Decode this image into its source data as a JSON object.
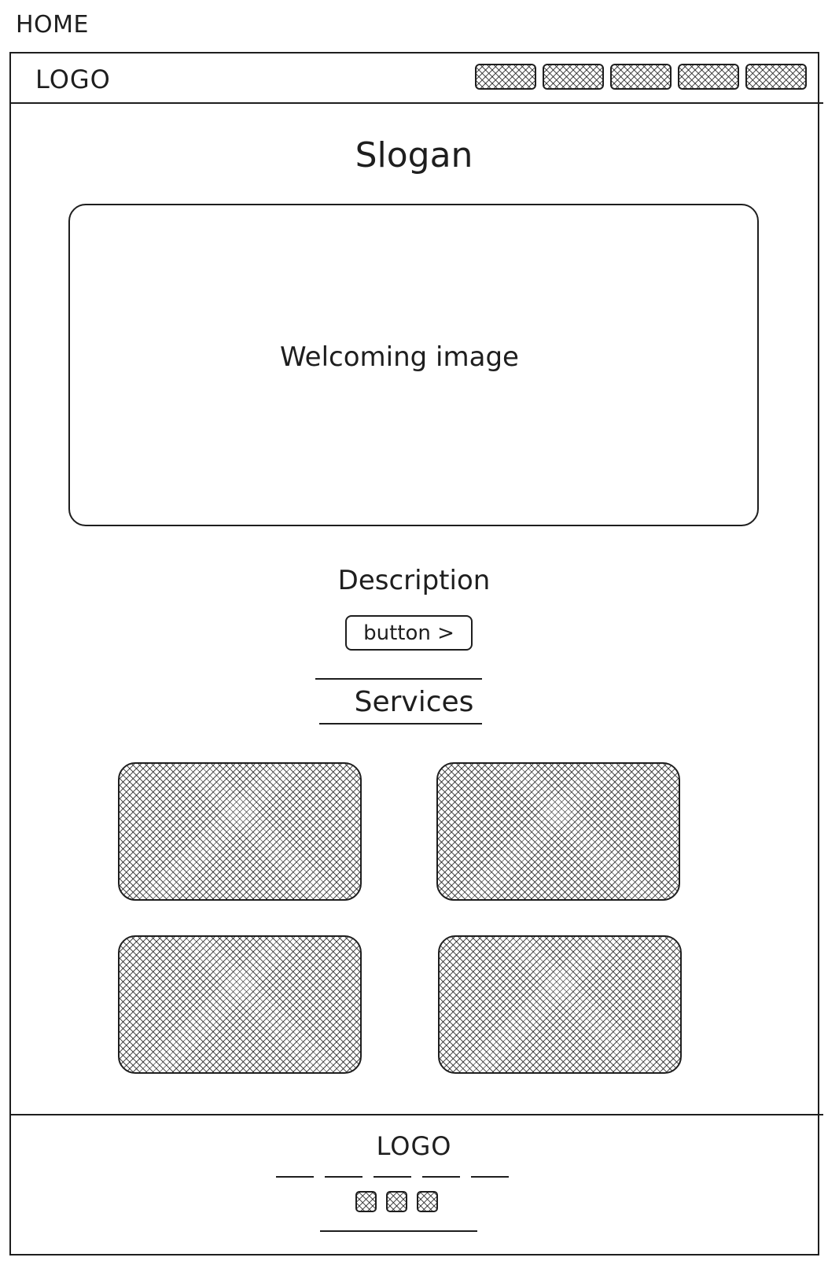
{
  "page_label": "HOME",
  "header": {
    "logo": "LOGO",
    "nav_items": [
      "",
      "",
      "",
      "",
      ""
    ]
  },
  "hero": {
    "slogan": "Slogan",
    "image_label": "Welcoming image"
  },
  "intro": {
    "description": "Description",
    "button_label": "button >"
  },
  "services": {
    "title": "Services",
    "cards": [
      "",
      "",
      "",
      ""
    ]
  },
  "footer": {
    "logo": "LOGO",
    "link_count": 5,
    "social_icon_count": 3
  },
  "colors": {
    "stroke": "#1e1e1e",
    "background": "#ffffff"
  }
}
